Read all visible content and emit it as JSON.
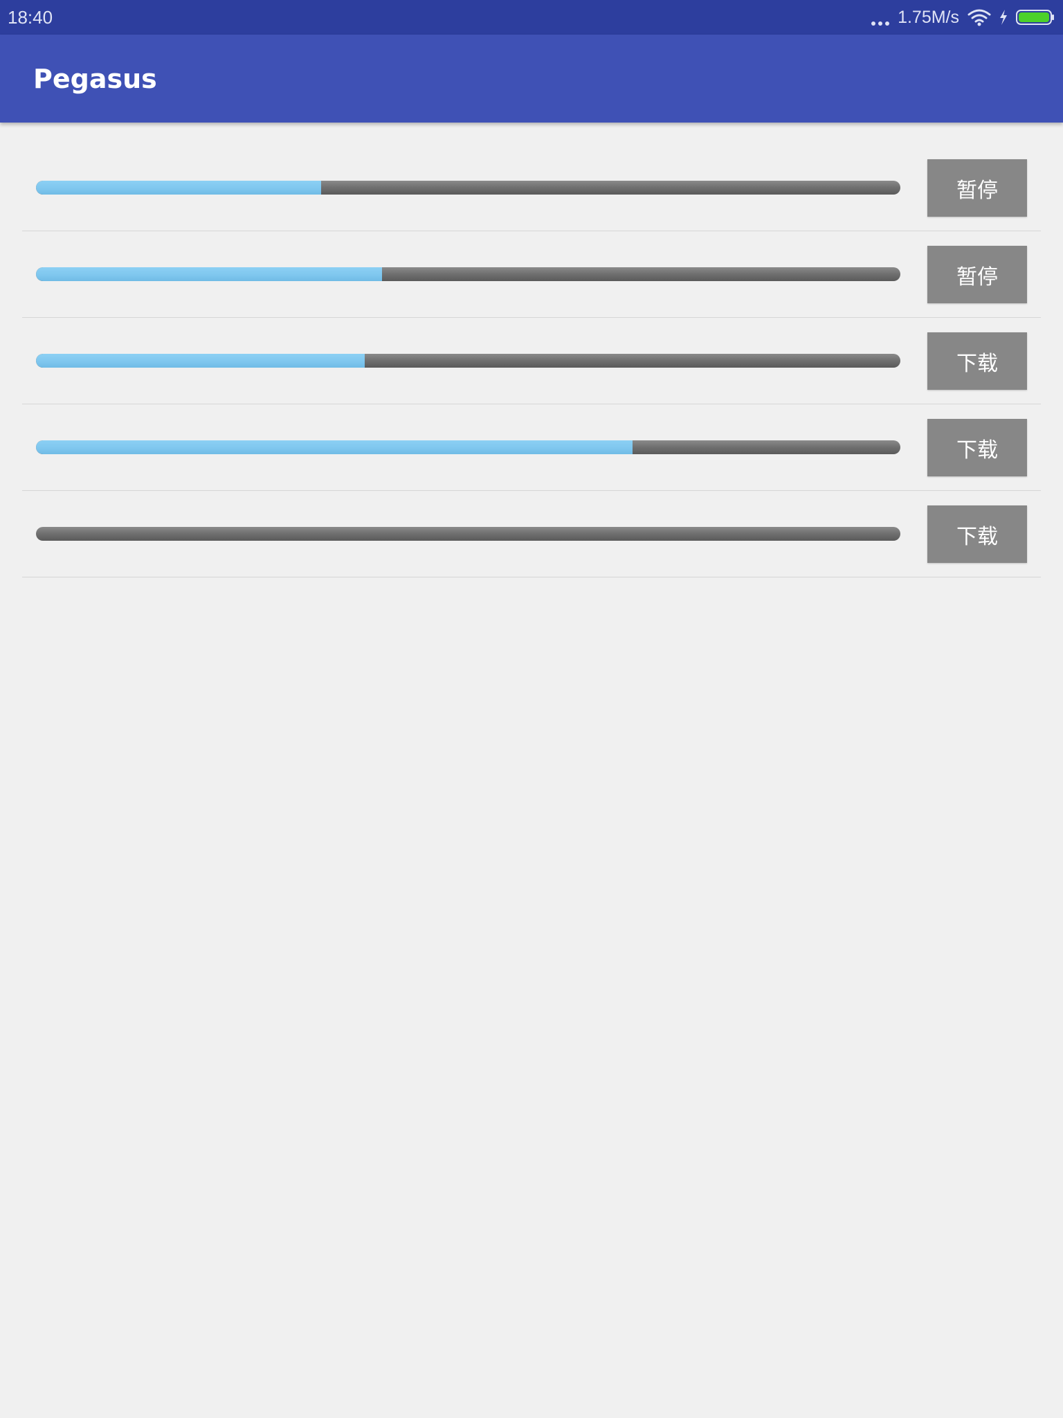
{
  "status_bar": {
    "time": "18:40",
    "net_speed": "1.75M/s",
    "icons": [
      "more-dots-icon",
      "wifi-icon",
      "charging-bolt-icon",
      "battery-icon"
    ],
    "battery_color": "#4cd12a"
  },
  "app_bar": {
    "title": "Pegasus",
    "color": "#3f51b5"
  },
  "downloads": [
    {
      "progress": 0.33,
      "button_label": "暂停"
    },
    {
      "progress": 0.4,
      "button_label": "暂停"
    },
    {
      "progress": 0.38,
      "button_label": "下载"
    },
    {
      "progress": 0.69,
      "button_label": "下载"
    },
    {
      "progress": 0.0,
      "button_label": "下载"
    }
  ],
  "colors": {
    "progress_fill": "#7ec6ee",
    "progress_track": "#6f6f6f",
    "button_bg": "#878787",
    "background": "#f0f0f0"
  }
}
